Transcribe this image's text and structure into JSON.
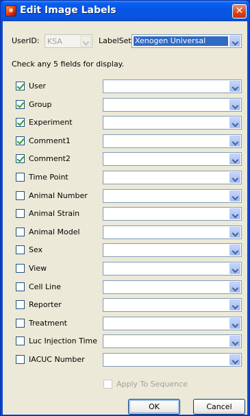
{
  "window": {
    "title": "Edit Image Labels",
    "close_glyph": "✕"
  },
  "top": {
    "userid_label": "UserID:",
    "userid_value": "KSA",
    "labelset_label": "LabelSet:",
    "labelset_value": "Xenogen Universal"
  },
  "instruction": "Check any 5 fields for display.",
  "fields": [
    {
      "label": "User",
      "checked": true,
      "value": ""
    },
    {
      "label": "Group",
      "checked": true,
      "value": ""
    },
    {
      "label": "Experiment",
      "checked": true,
      "value": ""
    },
    {
      "label": "Comment1",
      "checked": true,
      "value": ""
    },
    {
      "label": "Comment2",
      "checked": true,
      "value": ""
    },
    {
      "label": "Time Point",
      "checked": false,
      "value": ""
    },
    {
      "label": "Animal Number",
      "checked": false,
      "value": ""
    },
    {
      "label": "Animal Strain",
      "checked": false,
      "value": ""
    },
    {
      "label": "Animal Model",
      "checked": false,
      "value": ""
    },
    {
      "label": "Sex",
      "checked": false,
      "value": ""
    },
    {
      "label": "View",
      "checked": false,
      "value": ""
    },
    {
      "label": "Cell Line",
      "checked": false,
      "value": ""
    },
    {
      "label": "Reporter",
      "checked": false,
      "value": ""
    },
    {
      "label": "Treatment",
      "checked": false,
      "value": ""
    },
    {
      "label": "Luc Injection Time",
      "checked": false,
      "value": ""
    },
    {
      "label": "IACUC Number",
      "checked": false,
      "value": ""
    }
  ],
  "apply_to_sequence": {
    "label": "Apply To Sequence",
    "checked": false
  },
  "buttons": {
    "ok": "OK",
    "cancel": "Cancel"
  },
  "colors": {
    "title_bar": "#0a5ff0",
    "client_bg": "#ece9d8",
    "selection": "#316ac5",
    "check_mark": "#21a121"
  }
}
